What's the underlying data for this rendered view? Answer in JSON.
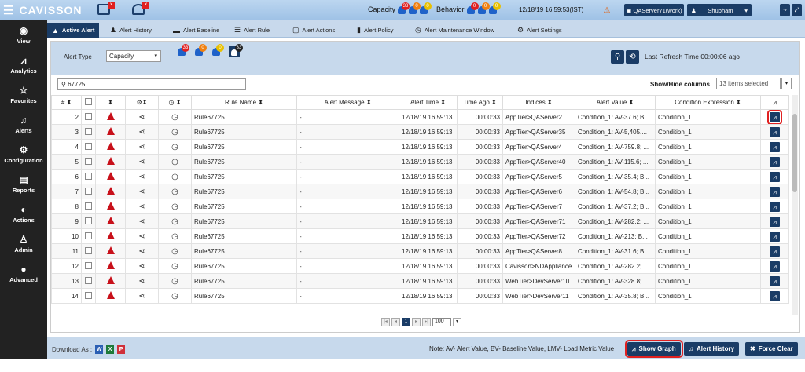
{
  "app": {
    "name": "CAVISSON",
    "capacity_label": "Capacity",
    "behavior_label": "Behavior",
    "cap_counts": [
      "33",
      "0",
      "0"
    ],
    "beh_counts": [
      "0",
      "0",
      "0"
    ],
    "datetime": "12/18/19 16:59:53(IST)",
    "server": "QAServer71(work)",
    "user": "Shubham",
    "help": "?",
    "top_badges": [
      "x",
      "x"
    ]
  },
  "sidebar": {
    "items": [
      {
        "label": "View",
        "icon": "◉"
      },
      {
        "label": "Analytics",
        "icon": "⩘"
      },
      {
        "label": "Favorites",
        "icon": "☆"
      },
      {
        "label": "Alerts",
        "icon": "♫"
      },
      {
        "label": "Configuration",
        "icon": "⚙"
      },
      {
        "label": "Reports",
        "icon": "▤"
      },
      {
        "label": "Actions",
        "icon": "◐"
      },
      {
        "label": "Admin",
        "icon": "♙"
      },
      {
        "label": "Advanced",
        "icon": "●"
      }
    ]
  },
  "tabs": [
    {
      "label": "Active Alert",
      "icon": "▲"
    },
    {
      "label": "Alert History",
      "icon": "♟"
    },
    {
      "label": "Alert Baseline",
      "icon": "▬"
    },
    {
      "label": "Alert Rule",
      "icon": "☰"
    },
    {
      "label": "Alert Actions",
      "icon": "▢"
    },
    {
      "label": "Alert Policy",
      "icon": "▮"
    },
    {
      "label": "Alert Maintenance Window",
      "icon": "◷"
    },
    {
      "label": "Alert Settings",
      "icon": "⚙"
    }
  ],
  "filter": {
    "label": "Alert Type",
    "value": "Capacity",
    "bell_counts": [
      "33",
      "0",
      "0",
      "33"
    ],
    "refresh": "Last Refresh Time 00:00:06 ago"
  },
  "search": {
    "value": "67725",
    "showhide_label": "Show/Hide columns",
    "columns_selected": "13 items selected"
  },
  "table": {
    "headers": [
      "# ⬍",
      "",
      "⬍",
      "⚙⬍",
      "◷ ⬍",
      "Rule Name ⬍",
      "Alert Message ⬍",
      "Alert Time ⬍",
      "Time Ago ⬍",
      "Indices ⬍",
      "Alert Value ⬍",
      "Condition Expression ⬍",
      ""
    ],
    "rows": [
      {
        "n": "2",
        "rule": "Rule67725",
        "msg": "-",
        "time": "12/18/19 16:59:13",
        "ago": "00:00:33",
        "idx": "AppTier>QAServer2",
        "val": "Condition_1: AV-37.6; B...",
        "cond": "Condition_1"
      },
      {
        "n": "3",
        "rule": "Rule67725",
        "msg": "-",
        "time": "12/18/19 16:59:13",
        "ago": "00:00:33",
        "idx": "AppTier>QAServer35",
        "val": "Condition_1: AV-5,405....",
        "cond": "Condition_1"
      },
      {
        "n": "4",
        "rule": "Rule67725",
        "msg": "-",
        "time": "12/18/19 16:59:13",
        "ago": "00:00:33",
        "idx": "AppTier>QAServer4",
        "val": "Condition_1: AV-759.8; ...",
        "cond": "Condition_1"
      },
      {
        "n": "5",
        "rule": "Rule67725",
        "msg": "-",
        "time": "12/18/19 16:59:13",
        "ago": "00:00:33",
        "idx": "AppTier>QAServer40",
        "val": "Condition_1: AV-115.6; ...",
        "cond": "Condition_1"
      },
      {
        "n": "6",
        "rule": "Rule67725",
        "msg": "-",
        "time": "12/18/19 16:59:13",
        "ago": "00:00:33",
        "idx": "AppTier>QAServer5",
        "val": "Condition_1: AV-35.4; B...",
        "cond": "Condition_1"
      },
      {
        "n": "7",
        "rule": "Rule67725",
        "msg": "-",
        "time": "12/18/19 16:59:13",
        "ago": "00:00:33",
        "idx": "AppTier>QAServer6",
        "val": "Condition_1: AV-54.8; B...",
        "cond": "Condition_1"
      },
      {
        "n": "8",
        "rule": "Rule67725",
        "msg": "-",
        "time": "12/18/19 16:59:13",
        "ago": "00:00:33",
        "idx": "AppTier>QAServer7",
        "val": "Condition_1: AV-37.2; B...",
        "cond": "Condition_1"
      },
      {
        "n": "9",
        "rule": "Rule67725",
        "msg": "-",
        "time": "12/18/19 16:59:13",
        "ago": "00:00:33",
        "idx": "AppTier>QAServer71",
        "val": "Condition_1: AV-282.2; ...",
        "cond": "Condition_1"
      },
      {
        "n": "10",
        "rule": "Rule67725",
        "msg": "-",
        "time": "12/18/19 16:59:13",
        "ago": "00:00:33",
        "idx": "AppTier>QAServer72",
        "val": "Condition_1: AV-213; B...",
        "cond": "Condition_1"
      },
      {
        "n": "11",
        "rule": "Rule67725",
        "msg": "-",
        "time": "12/18/19 16:59:13",
        "ago": "00:00:33",
        "idx": "AppTier>QAServer8",
        "val": "Condition_1: AV-31.6; B...",
        "cond": "Condition_1"
      },
      {
        "n": "12",
        "rule": "Rule67725",
        "msg": "-",
        "time": "12/18/19 16:59:13",
        "ago": "00:00:33",
        "idx": "Cavisson>NDAppliance",
        "val": "Condition_1: AV-282.2; ...",
        "cond": "Condition_1"
      },
      {
        "n": "13",
        "rule": "Rule67725",
        "msg": "-",
        "time": "12/18/19 16:59:13",
        "ago": "00:00:33",
        "idx": "WebTier>DevServer10",
        "val": "Condition_1: AV-328.8; ...",
        "cond": "Condition_1"
      },
      {
        "n": "14",
        "rule": "Rule67725",
        "msg": "-",
        "time": "12/18/19 16:59:13",
        "ago": "00:00:33",
        "idx": "WebTier>DevServer11",
        "val": "Condition_1: AV-35.8; B...",
        "cond": "Condition_1"
      }
    ]
  },
  "pager": {
    "page": "1",
    "size": "100"
  },
  "footer": {
    "download": "Download As :",
    "note": "Note: AV- Alert Value, BV- Baseline Value, LMV- Load Metric Value",
    "show_graph": "Show Graph",
    "alert_history": "Alert History",
    "force_clear": "Force Clear"
  },
  "colors": {
    "accent": "#1a3c66",
    "critical": "#c8101a",
    "highlight": "#e02020"
  }
}
